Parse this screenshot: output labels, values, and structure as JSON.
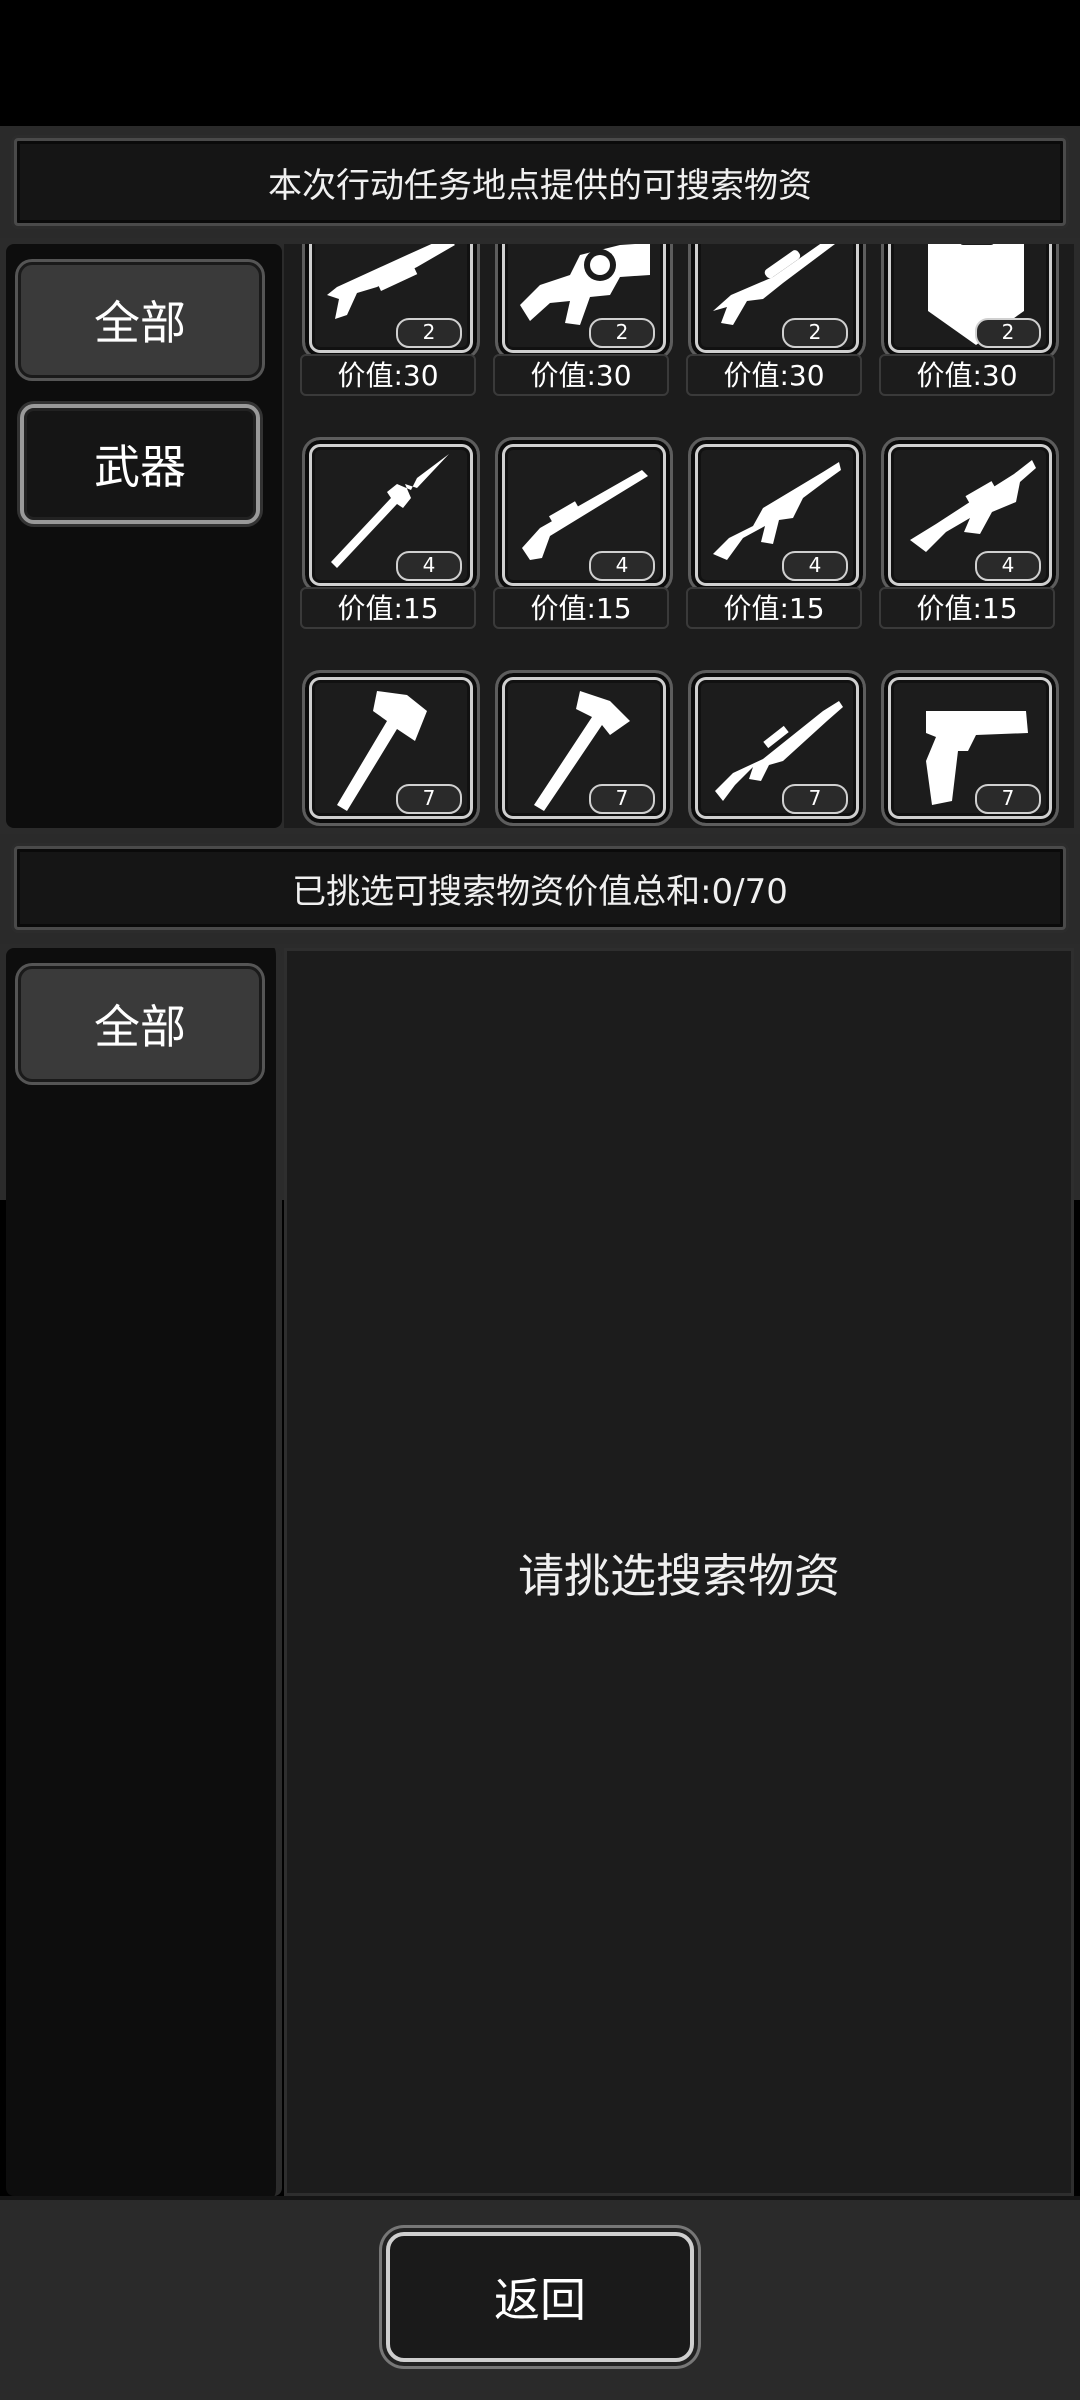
{
  "top_bar": {
    "title": "本次行动任务地点提供的可搜索物资"
  },
  "upper_panel": {
    "tabs": [
      {
        "label": "全部",
        "selected": true
      },
      {
        "label": "武器",
        "selected": false
      }
    ],
    "items": [
      {
        "icon": "shotgun-icon",
        "count": "2",
        "price": "价值:30"
      },
      {
        "icon": "grenade-launcher-icon",
        "count": "2",
        "price": "价值:30"
      },
      {
        "icon": "sniper-rifle-icon",
        "count": "2",
        "price": "价值:30"
      },
      {
        "icon": "riot-shield-icon",
        "count": "2",
        "price": "价值:30"
      },
      {
        "icon": "spear-icon",
        "count": "4",
        "price": "价值:15"
      },
      {
        "icon": "double-barrel-shotgun-icon",
        "count": "4",
        "price": "价值:15"
      },
      {
        "icon": "assault-rifle-icon",
        "count": "4",
        "price": "价值:15"
      },
      {
        "icon": "bullpup-rifle-icon",
        "count": "4",
        "price": "价值:15"
      },
      {
        "icon": "axe-icon",
        "count": "7",
        "price": ""
      },
      {
        "icon": "hammer-axe-icon",
        "count": "7",
        "price": ""
      },
      {
        "icon": "m16-rifle-icon",
        "count": "7",
        "price": ""
      },
      {
        "icon": "pistol-icon",
        "count": "7",
        "price": ""
      }
    ]
  },
  "middle_bar": {
    "title": "已挑选可搜索物资价值总和:0/70"
  },
  "lower_panel": {
    "tabs": [
      {
        "label": "全部",
        "selected": true
      }
    ],
    "empty_message": "请挑选搜索物资"
  },
  "footer": {
    "back_label": "返回"
  },
  "colors": {
    "background": "#000000",
    "panel": "#1c1c1c",
    "frame": "#2b2b2b",
    "text": "#ffffff"
  }
}
